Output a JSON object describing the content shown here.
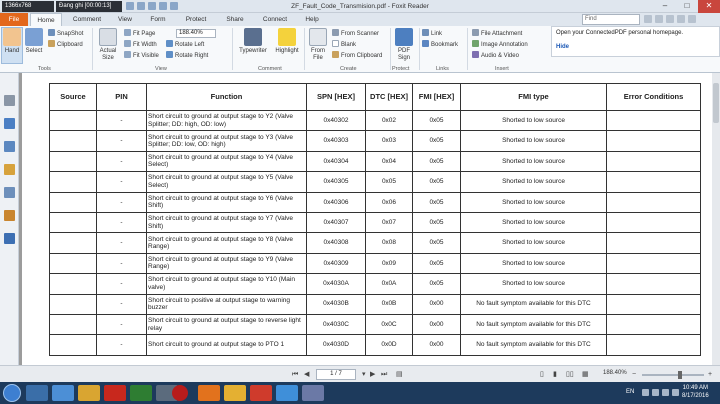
{
  "titlebar": {
    "resolution": "1366x768",
    "recording": "Đang ghi [00:00:13]",
    "title": "ZF_Fault_Code_Transmision.pdf - Foxit Reader"
  },
  "tabs": [
    "File",
    "Home",
    "Comment",
    "View",
    "Form",
    "Protect",
    "Share",
    "Connect",
    "Help"
  ],
  "active_tab": "Home",
  "find_placeholder": "Find",
  "ribbon": {
    "hand": "Hand",
    "select": "Select",
    "snapshot": "SnapShot",
    "clipboard": "Clipboard",
    "actual_size": "Actual Size",
    "fit_page": "Fit Page",
    "fit_width": "Fit Width",
    "fit_visible": "Fit Visible",
    "zoom_value": "188.40%",
    "rotate_left": "Rotate Left",
    "rotate_right": "Rotate Right",
    "typewriter": "Typewriter",
    "highlight": "Highlight",
    "from_file": "From File",
    "from_scanner": "From Scanner",
    "blank": "Blank",
    "from_clipboard": "From Clipboard",
    "pdf_sign": "PDF Sign",
    "link": "Link",
    "bookmark": "Bookmark",
    "file_attachment": "File Attachment",
    "image_annotation": "Image Annotation",
    "audio_video": "Audio & Video",
    "groups": {
      "tools": "Tools",
      "view": "View",
      "comment": "Comment",
      "create": "Create",
      "protect": "Protect",
      "links": "Links",
      "insert": "Insert"
    }
  },
  "notification": {
    "text": "Open your ConnectedPDF personal homepage.",
    "hide": "Hide"
  },
  "table": {
    "headers": [
      "Source",
      "PIN",
      "Function",
      "SPN [HEX]",
      "DTC [HEX]",
      "FMI [HEX]",
      "FMI type",
      "Error Conditions"
    ],
    "rows": [
      [
        "",
        "-",
        "Short circuit to ground at output stage to Y2 (Valve Splitter; DD: high, OD: low)",
        "0x40302",
        "0x02",
        "0x05",
        "Shorted to low source",
        ""
      ],
      [
        "",
        "-",
        "Short circuit to ground at output stage to Y3 (Valve Splitter; DD: low, OD: high)",
        "0x40303",
        "0x03",
        "0x05",
        "Shorted to low source",
        ""
      ],
      [
        "",
        "-",
        "Short circuit to ground at output stage to Y4 (Valve Select)",
        "0x40304",
        "0x04",
        "0x05",
        "Shorted to low source",
        ""
      ],
      [
        "",
        "-",
        "Short circuit to ground at output stage to Y5 (Valve Select)",
        "0x40305",
        "0x05",
        "0x05",
        "Shorted to low source",
        ""
      ],
      [
        "",
        "-",
        "Short circuit to ground at output stage to Y6 (Valve Shift)",
        "0x40306",
        "0x06",
        "0x05",
        "Shorted to low source",
        ""
      ],
      [
        "",
        "-",
        "Short circuit to ground at output stage to Y7 (Valve Shift)",
        "0x40307",
        "0x07",
        "0x05",
        "Shorted to low source",
        ""
      ],
      [
        "",
        "-",
        "Short circuit to ground at output stage to Y8 (Valve Range)",
        "0x40308",
        "0x08",
        "0x05",
        "Shorted to low source",
        ""
      ],
      [
        "",
        "-",
        "Short circuit to ground at output stage to Y9 (Valve Range)",
        "0x40309",
        "0x09",
        "0x05",
        "Shorted to low source",
        ""
      ],
      [
        "",
        "-",
        "Short circuit to ground at output stage to Y10 (Main valve)",
        "0x4030A",
        "0x0A",
        "0x05",
        "Shorted to low source",
        ""
      ],
      [
        "",
        "-",
        "Short circuit to positive at output stage to warning buzzer",
        "0x4030B",
        "0x0B",
        "0x00",
        "No fault symptom available for this DTC",
        ""
      ],
      [
        "",
        "-",
        "Short circuit to ground at output stage to reverse light relay",
        "0x4030C",
        "0x0C",
        "0x00",
        "No fault symptom available for this DTC",
        ""
      ],
      [
        "",
        "-",
        "Short circuit to ground at output stage to PTO 1",
        "0x4030D",
        "0x0D",
        "0x00",
        "No fault symptom available for this DTC",
        ""
      ]
    ]
  },
  "status": {
    "page": "1 / 7",
    "zoom": "188.40%"
  },
  "taskbar": {
    "lang": "EN",
    "time": "10:49 AM",
    "date": "8/17/2016"
  },
  "colors": {
    "file_tab": "#e3671c",
    "accent_blue": "#1a57b5",
    "taskbar": "#1d3a5c"
  }
}
